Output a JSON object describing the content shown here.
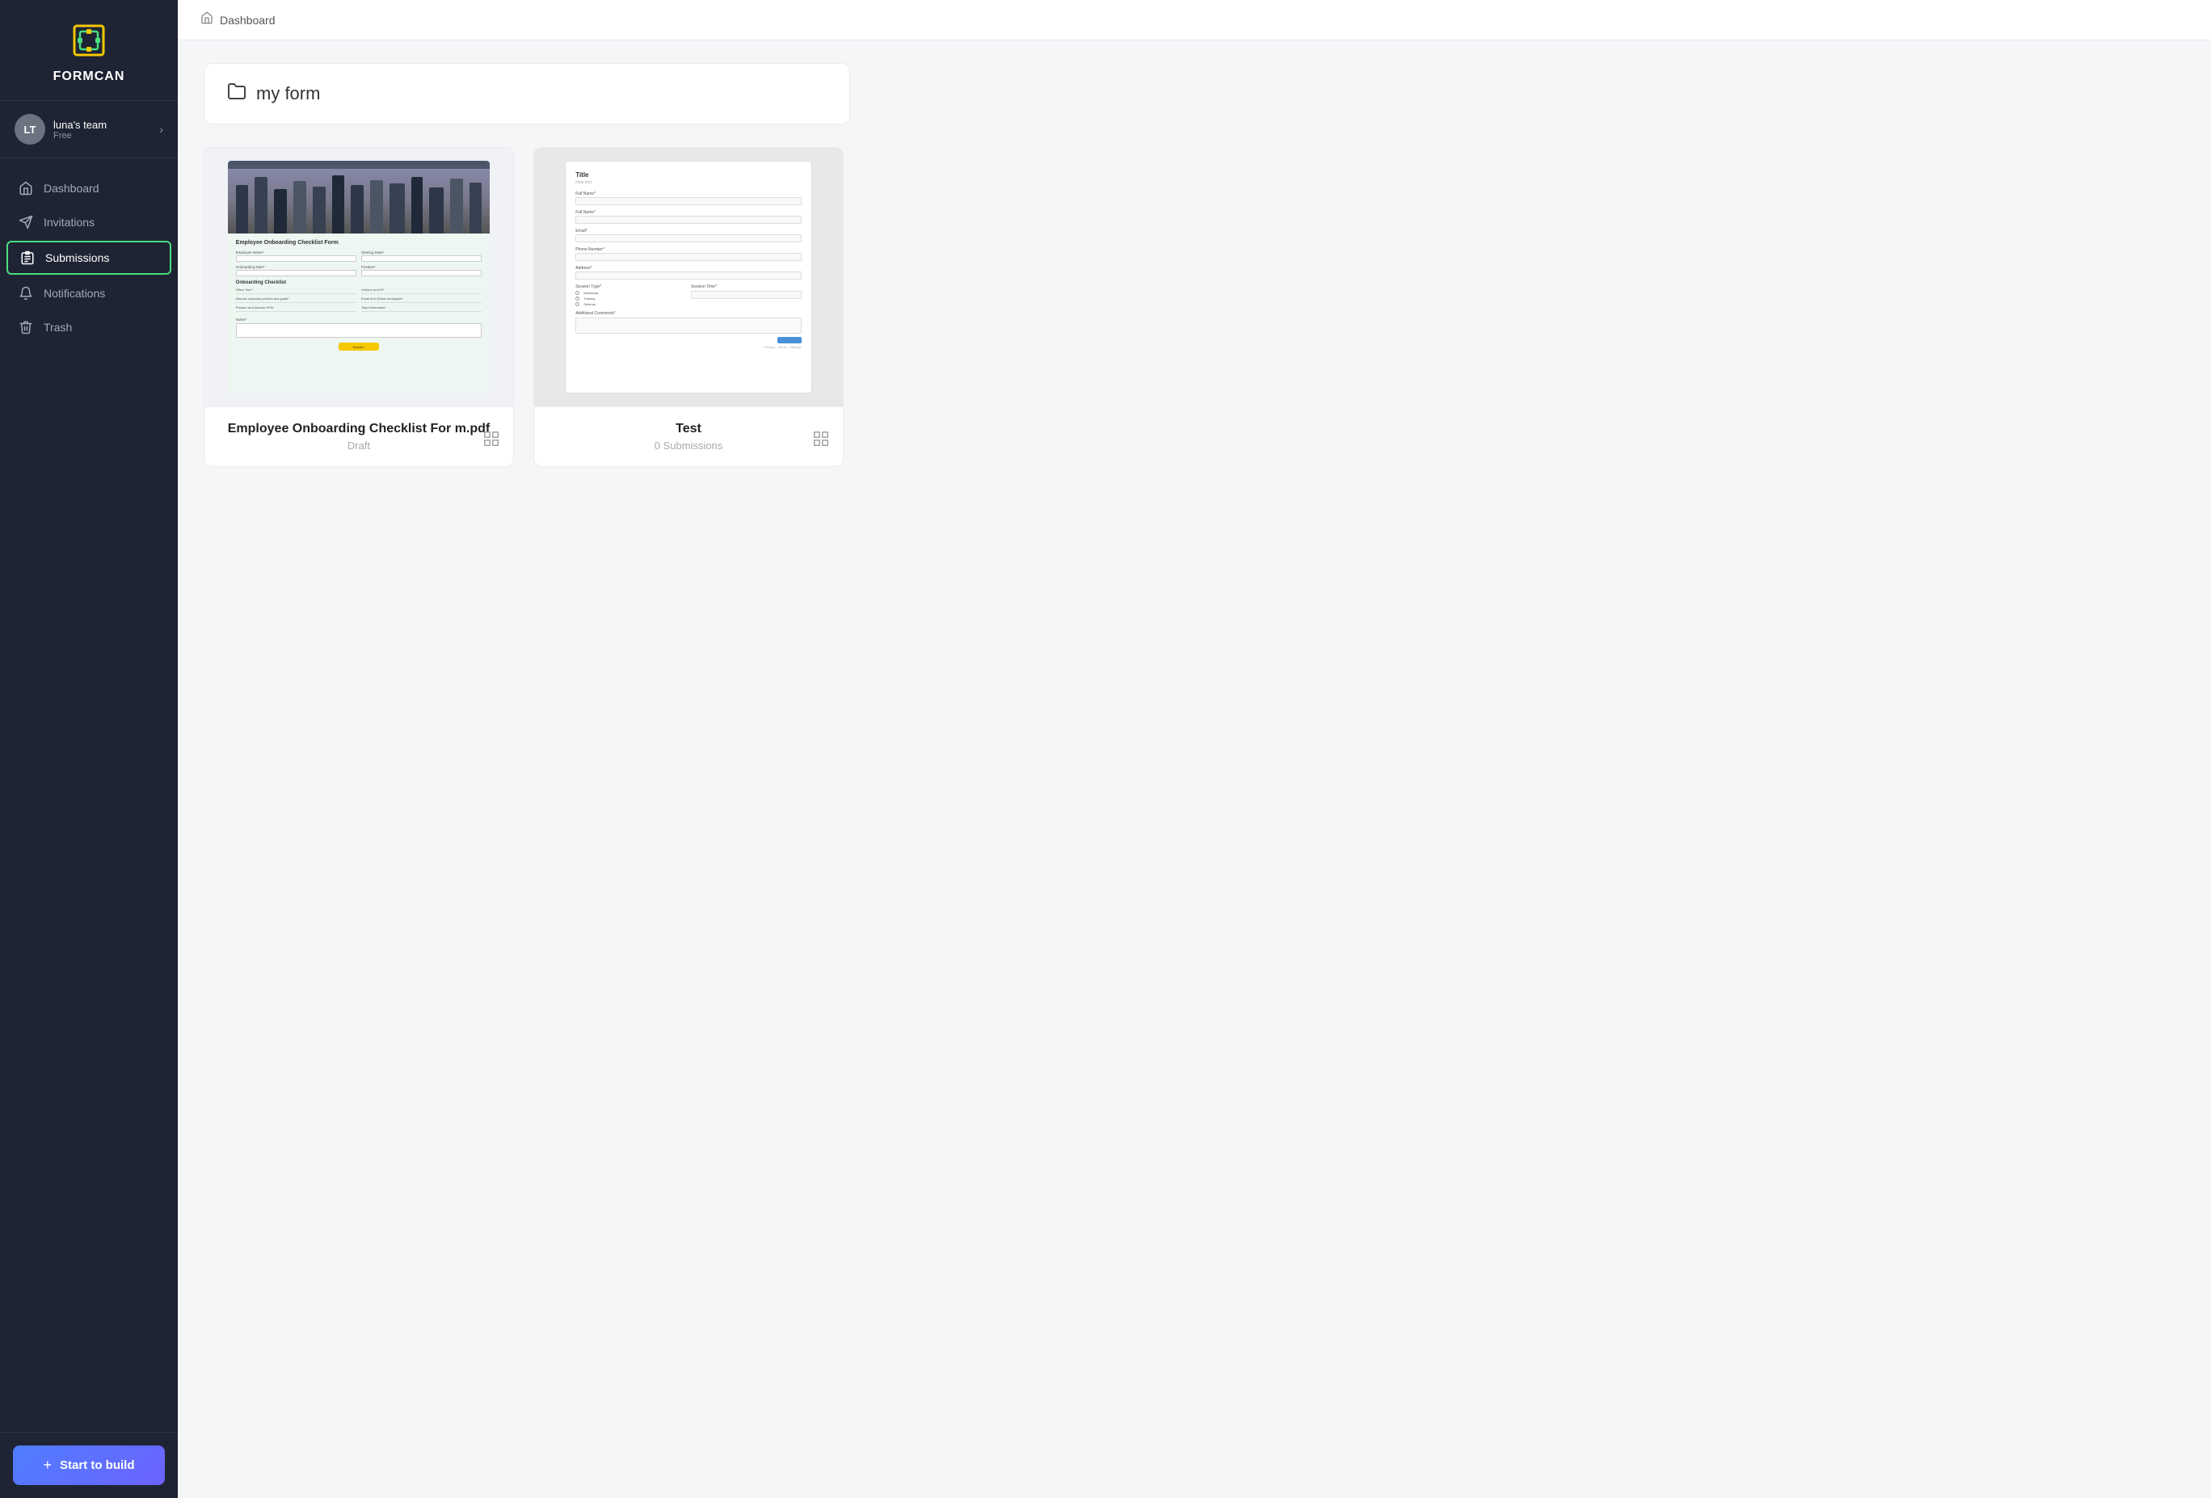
{
  "brand": {
    "name": "FORMCAN"
  },
  "team": {
    "initials": "LT",
    "name": "luna's team",
    "plan": "Free"
  },
  "sidebar": {
    "nav_items": [
      {
        "id": "dashboard",
        "label": "Dashboard",
        "active": false
      },
      {
        "id": "invitations",
        "label": "Invitations",
        "active": false
      },
      {
        "id": "submissions",
        "label": "Submissions",
        "active": true
      },
      {
        "id": "notifications",
        "label": "Notifications",
        "active": false
      },
      {
        "id": "trash",
        "label": "Trash",
        "active": false
      }
    ],
    "start_build_label": "Start to build",
    "start_build_plus": "+"
  },
  "breadcrumb": {
    "home_icon": "🏠",
    "label": "Dashboard"
  },
  "folder": {
    "icon": "🗂",
    "name": "my form"
  },
  "forms": [
    {
      "id": "onboarding",
      "title": "Employee Onboarding Checklist For m.pdf",
      "status": "Draft",
      "submissions": null,
      "type": "onboarding"
    },
    {
      "id": "test",
      "title": "Test",
      "status": null,
      "submissions": "0 Submissions",
      "type": "test"
    }
  ]
}
